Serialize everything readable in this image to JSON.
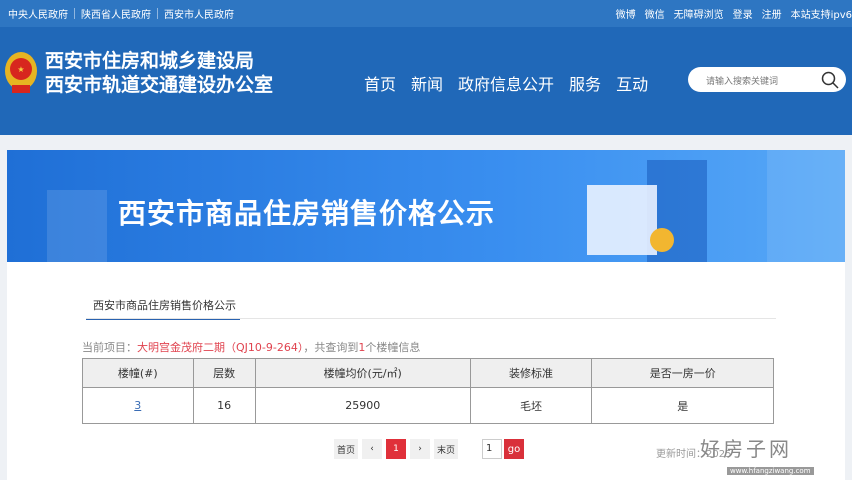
{
  "topbar": {
    "left_links": [
      "中央人民政府",
      "陕西省人民政府",
      "西安市人民政府"
    ],
    "right_links": [
      "微博",
      "微信",
      "无障碍浏览",
      "登录",
      "注册",
      "本站支持ipv6"
    ]
  },
  "header": {
    "org_line1": "西安市住房和城乡建设局",
    "org_line2": "西安市轨道交通建设办公室",
    "nav": [
      "首页",
      "新闻",
      "政府信息公开",
      "服务",
      "互动"
    ],
    "search_placeholder": "请输入搜索关键词"
  },
  "banner": {
    "title": "西安市商品住房销售价格公示"
  },
  "main": {
    "tab": "西安市商品住房销售价格公示",
    "info": {
      "prefix": "当前项目：",
      "project": "大明宫金茂府二期（QJ10-9-264）",
      "mid": "，共查询到",
      "count": "1",
      "suffix": "个楼幢信息"
    },
    "table": {
      "headers": [
        "楼幢(#)",
        "层数",
        "楼幢均价(元/㎡)",
        "装修标准",
        "是否一房一价"
      ],
      "rows": [
        [
          "3",
          "16",
          "25900",
          "毛坯",
          "是"
        ]
      ]
    },
    "pager": {
      "first": "首页",
      "prev": "‹",
      "current": "1",
      "next": "›",
      "last": "末页",
      "page_input": "1",
      "go": "go"
    },
    "update": "更新时间：2025"
  },
  "watermark": {
    "text": "好房子网",
    "url": "www.hfangziwang.com"
  },
  "colors": {
    "header_blue": "#2068b8",
    "accent_red": "#e0303a",
    "tab_underline": "#2962b0"
  }
}
